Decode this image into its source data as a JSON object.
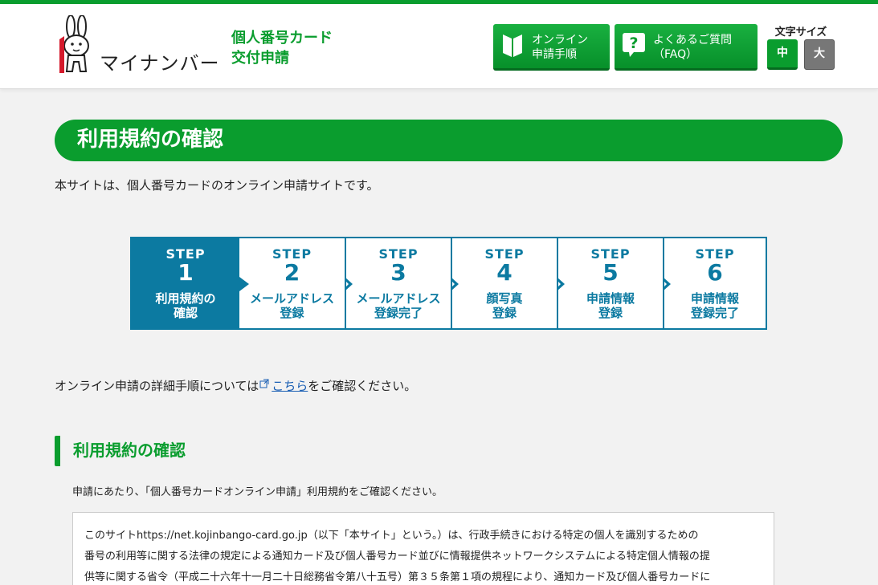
{
  "header": {
    "logo_text": "マイナンバー",
    "title_line1": "個人番号カード",
    "title_line2": "交付申請",
    "online_button": {
      "line1": "オンライン",
      "line2": "申請手順"
    },
    "faq_button": {
      "line1": "よくあるご質問",
      "line2": "（FAQ）"
    },
    "font_size": {
      "label": "文字サイズ",
      "medium": "中",
      "large": "大"
    }
  },
  "page": {
    "heading": "利用規約の確認",
    "intro": "本サイトは、個人番号カードのオンライン申請サイトです。"
  },
  "steps": [
    {
      "word": "STEP",
      "num": "1",
      "line1": "利用規約の",
      "line2": "確認",
      "active": true
    },
    {
      "word": "STEP",
      "num": "2",
      "line1": "メールアドレス",
      "line2": "登録",
      "active": false
    },
    {
      "word": "STEP",
      "num": "3",
      "line1": "メールアドレス",
      "line2": "登録完了",
      "active": false
    },
    {
      "word": "STEP",
      "num": "4",
      "line1": "顔写真",
      "line2": "登録",
      "active": false
    },
    {
      "word": "STEP",
      "num": "5",
      "line1": "申請情報",
      "line2": "登録",
      "active": false
    },
    {
      "word": "STEP",
      "num": "6",
      "line1": "申請情報",
      "line2": "登録完了",
      "active": false
    }
  ],
  "procedure": {
    "before": "オンライン申請の詳細手順については",
    "link": "こちら",
    "after": "をご確認ください。"
  },
  "section": {
    "heading": "利用規約の確認",
    "note": "申請にあたり、「個人番号カードオンライン申請」利用規約をご確認ください。",
    "terms_lines": [
      "このサイトhttps://net.kojinbango-card.go.jp（以下「本サイト」という。）は、行政手続きにおける特定の個人を識別するための",
      "番号の利用等に関する法律の規定による通知カード及び個人番号カード並びに情報提供ネットワークシステムによる特定個人情報の提",
      "供等に関する省令（平成二十六年十一月二十日総務省令第八十五号）第３５条第１項の規程により、通知カード及び個人番号カードに"
    ]
  },
  "colors": {
    "green": "#0a9d2e",
    "step_blue": "#0c7aa1",
    "link": "#1a5fb4"
  }
}
